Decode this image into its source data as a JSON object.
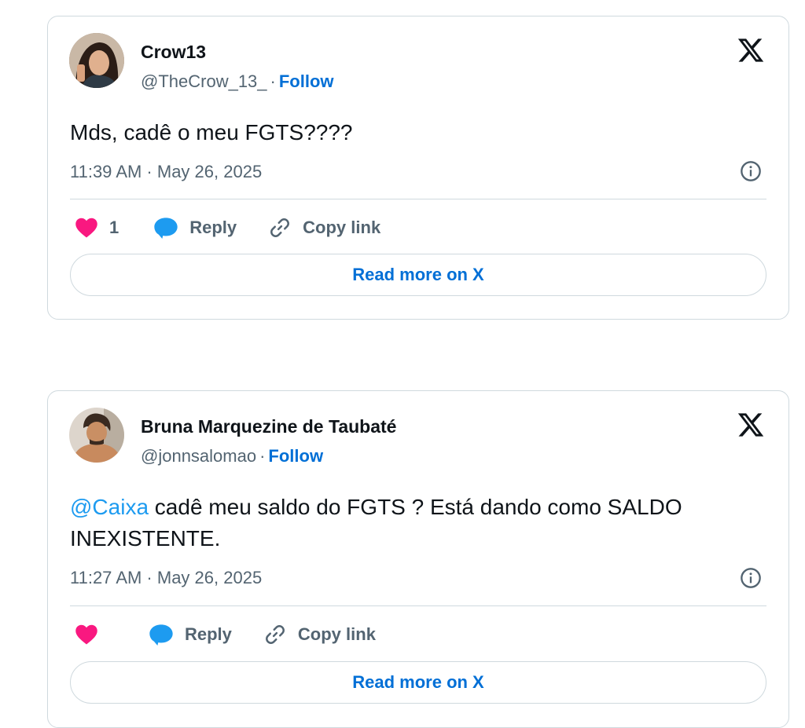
{
  "tweets": [
    {
      "author_name": "Crow13",
      "handle": "@TheCrow_13_",
      "separator": "·",
      "follow_label": "Follow",
      "text_mention": "",
      "text_body": "Mds, cadê o meu FGTS????",
      "timestamp": "11:39 AM · May 26, 2025",
      "like_count": "1",
      "reply_label": "Reply",
      "copy_label": "Copy link",
      "read_more_label": "Read more on X",
      "icons": [
        "x-logo-icon",
        "info-icon",
        "heart-icon",
        "reply-bubble-icon",
        "link-icon"
      ]
    },
    {
      "author_name": "Bruna Marquezine de Taubaté",
      "handle": "@jonnsalomao",
      "separator": "·",
      "follow_label": "Follow",
      "text_mention": "@Caixa",
      "text_body": " cadê meu saldo do FGTS ? Está dando como SALDO INEXISTENTE.",
      "timestamp": "11:27 AM · May 26, 2025",
      "like_count": "",
      "reply_label": "Reply",
      "copy_label": "Copy link",
      "read_more_label": "Read more on X",
      "icons": [
        "x-logo-icon",
        "info-icon",
        "heart-icon",
        "reply-bubble-icon",
        "link-icon"
      ]
    }
  ],
  "colors": {
    "follow": "#006fd6",
    "mention": "#1d9bf0",
    "like": "#f91880",
    "reply": "#1d9bf0",
    "secondary_text": "#536471",
    "border": "#cfd9de"
  }
}
